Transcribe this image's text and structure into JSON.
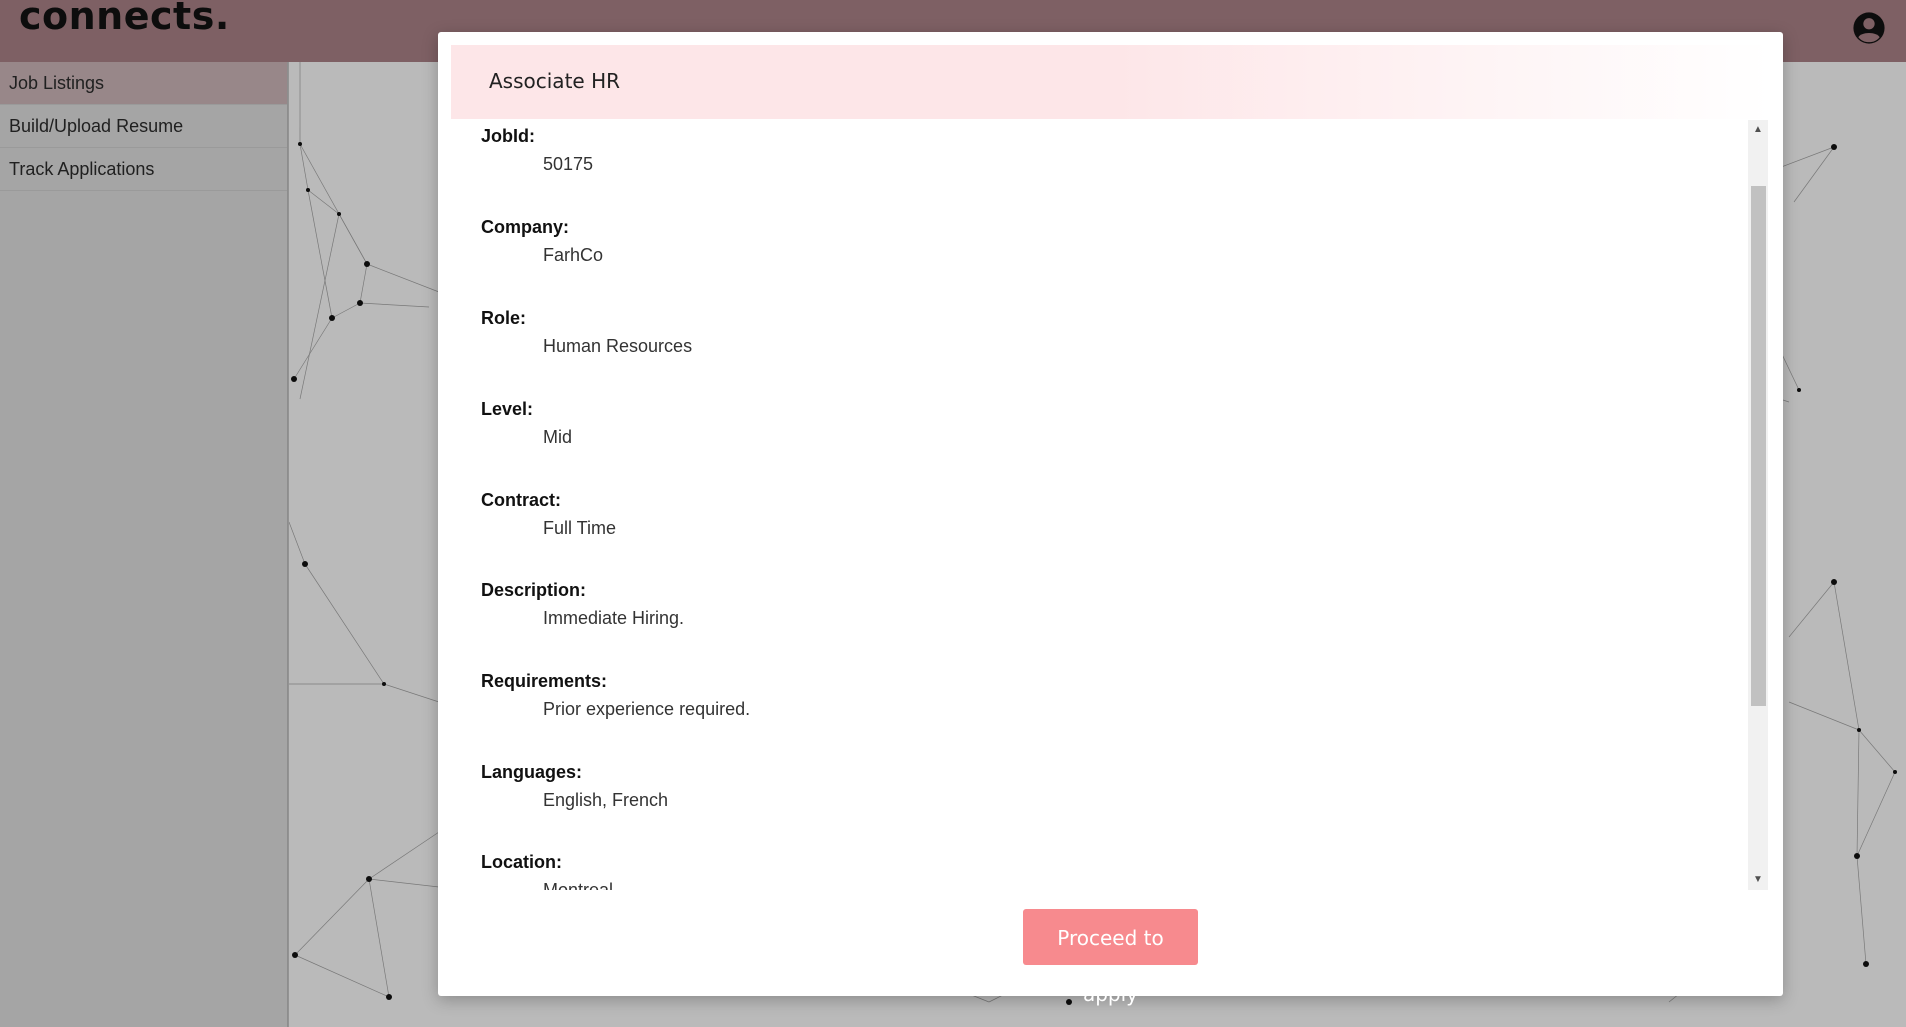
{
  "app": {
    "logo": "connects."
  },
  "header": {
    "account_icon": "account-circle-icon"
  },
  "sidebar": {
    "items": [
      {
        "label": "Job Listings",
        "active": true
      },
      {
        "label": "Build/Upload Resume",
        "active": false
      },
      {
        "label": "Track Applications",
        "active": false
      }
    ]
  },
  "modal": {
    "title": "Associate HR",
    "fields": [
      {
        "label": "JobId:",
        "value": "50175"
      },
      {
        "label": "Company:",
        "value": "FarhCo"
      },
      {
        "label": "Role:",
        "value": "Human Resources"
      },
      {
        "label": "Level:",
        "value": "Mid"
      },
      {
        "label": "Contract:",
        "value": "Full Time"
      },
      {
        "label": "Description:",
        "value": "Immediate Hiring."
      },
      {
        "label": "Requirements:",
        "value": "Prior experience required."
      },
      {
        "label": "Languages:",
        "value": "English, French"
      },
      {
        "label": "Location:",
        "value": "Montreal"
      }
    ],
    "apply_label": "Proceed to apply"
  },
  "colors": {
    "topbar": "#a27c80",
    "apply_button": "#f78a8e",
    "header_tint": "#fde6e8"
  }
}
